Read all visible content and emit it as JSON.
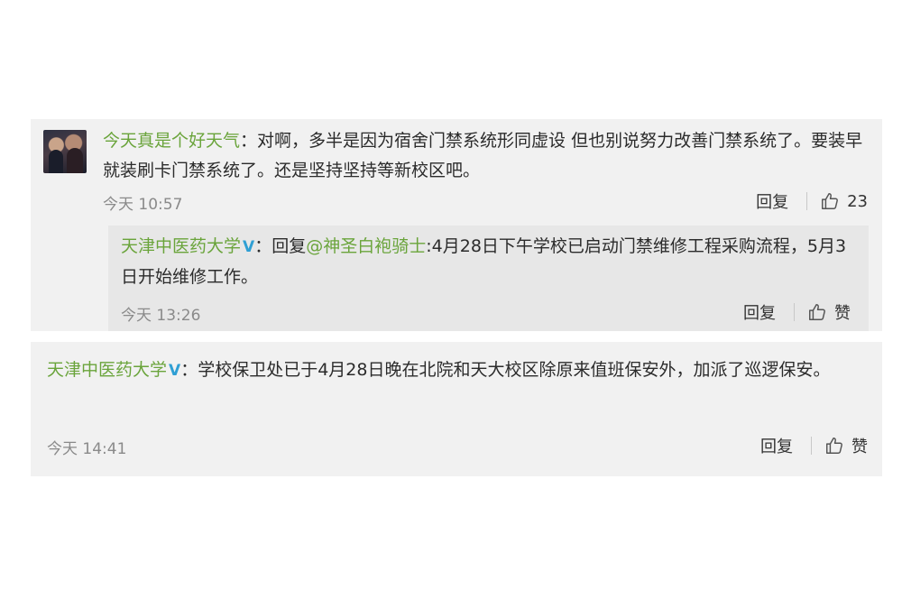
{
  "comment1": {
    "username": "今天真是个好天气",
    "separator": "：",
    "text": "对啊，多半是因为宿舍门禁系统形同虚设  但也别说努力改善门禁系统了。要装早就装刷卡门禁系统了。还是坚持坚持等新校区吧。",
    "time": "今天 10:57",
    "reply_label": "回复",
    "like_count": "23"
  },
  "nested_reply": {
    "username": "天津中医药大学",
    "verified_mark": "V",
    "separator": "：",
    "reply_prefix": "回复",
    "mention": "@神圣白袍骑士",
    "text": ":4月28日下午学校已启动门禁维修工程采购流程，5月3日开始维修工作。",
    "time": "今天 13:26",
    "reply_label": "回复",
    "like_label": "赞"
  },
  "comment2": {
    "username": "天津中医药大学",
    "verified_mark": "V",
    "separator": "：",
    "text": "学校保卫处已于4月28日晚在北院和天大校区除原来值班保安外，加派了巡逻保安。",
    "time": "今天 14:41",
    "reply_label": "回复",
    "like_label": "赞"
  },
  "icons": {
    "avatar": "user-avatar",
    "like": "thumbs-up-icon",
    "verified": "verified-badge-icon"
  },
  "colors": {
    "username": "#6aa43b",
    "verified": "#2f9fd4",
    "card_bg": "#f1f1f1",
    "nested_bg": "#e7e7e7"
  }
}
